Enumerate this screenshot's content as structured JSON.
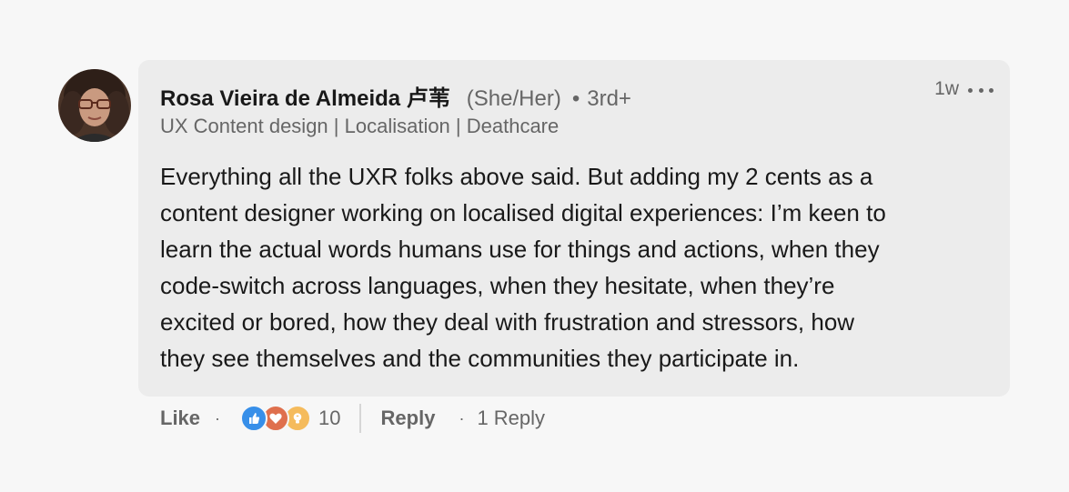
{
  "comment": {
    "author": {
      "name": "Rosa Vieira de Almeida 卢苇",
      "pronouns": "(She/Her)",
      "separator": "•",
      "degree": "3rd+",
      "headline": "UX Content design | Localisation | Deathcare",
      "avatar_icon": "profile-photo"
    },
    "timestamp": "1w",
    "more_icon": "ellipsis-icon",
    "text": "Everything all the UXR folks above said. But adding my 2 cents as a\ncontent designer working on localised digital experiences: I’m keen to\nlearn the actual words humans use for things and actions, when they\ncode-switch across languages, when they hesitate, when they’re\nexcited or bored, how they deal with frustration and stressors, how\nthey see themselves and the communities they participate in.",
    "actions": {
      "like_label": "Like",
      "dot": "·",
      "reactions": {
        "icons": [
          "like-icon",
          "love-icon",
          "insightful-icon"
        ],
        "count": "10"
      },
      "reply_label": "Reply",
      "reply_count": "1 Reply"
    }
  },
  "colors": {
    "background": "#f7f7f7",
    "bubble": "#ececec",
    "text_primary": "#191919",
    "text_secondary": "#666666",
    "like": "#378fe9",
    "love": "#df704d",
    "insightful": "#f5bb5c"
  }
}
